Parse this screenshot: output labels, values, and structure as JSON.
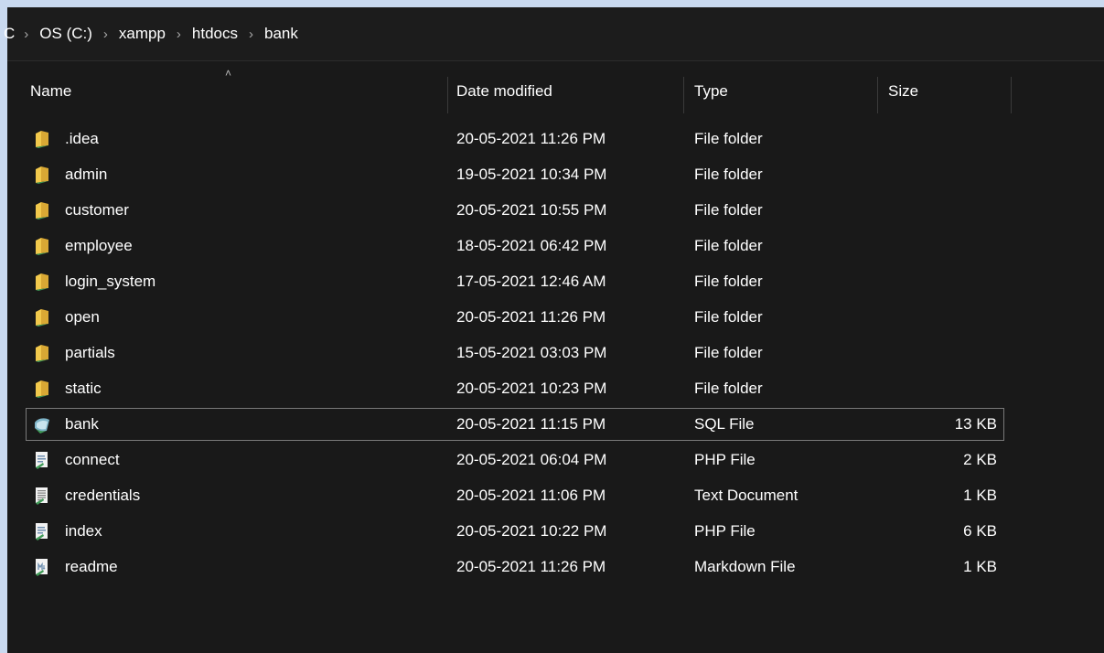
{
  "breadcrumb": {
    "items": [
      "C",
      "OS (C:)",
      "xampp",
      "htdocs",
      "bank"
    ],
    "separator": ">"
  },
  "columns": {
    "name": "Name",
    "date": "Date modified",
    "type": "Type",
    "size": "Size"
  },
  "files": [
    {
      "name": ".idea",
      "date": "20-05-2021 11:26 PM",
      "type": "File folder",
      "size": "",
      "icon": "folder-icon"
    },
    {
      "name": "admin",
      "date": "19-05-2021 10:34 PM",
      "type": "File folder",
      "size": "",
      "icon": "folder-icon"
    },
    {
      "name": "customer",
      "date": "20-05-2021 10:55 PM",
      "type": "File folder",
      "size": "",
      "icon": "folder-icon"
    },
    {
      "name": "employee",
      "date": "18-05-2021 06:42 PM",
      "type": "File folder",
      "size": "",
      "icon": "folder-icon"
    },
    {
      "name": "login_system",
      "date": "17-05-2021 12:46 AM",
      "type": "File folder",
      "size": "",
      "icon": "folder-icon"
    },
    {
      "name": "open",
      "date": "20-05-2021 11:26 PM",
      "type": "File folder",
      "size": "",
      "icon": "folder-icon"
    },
    {
      "name": "partials",
      "date": "15-05-2021 03:03 PM",
      "type": "File folder",
      "size": "",
      "icon": "folder-icon"
    },
    {
      "name": "static",
      "date": "20-05-2021 10:23 PM",
      "type": "File folder",
      "size": "",
      "icon": "folder-icon"
    },
    {
      "name": "bank",
      "date": "20-05-2021 11:15 PM",
      "type": "SQL File",
      "size": "13 KB",
      "icon": "sql-file-icon"
    },
    {
      "name": "connect",
      "date": "20-05-2021 06:04 PM",
      "type": "PHP File",
      "size": "2 KB",
      "icon": "php-file-icon"
    },
    {
      "name": "credentials",
      "date": "20-05-2021 11:06 PM",
      "type": "Text Document",
      "size": "1 KB",
      "icon": "text-file-icon"
    },
    {
      "name": "index",
      "date": "20-05-2021 10:22 PM",
      "type": "PHP File",
      "size": "6 KB",
      "icon": "php-file-icon"
    },
    {
      "name": "readme",
      "date": "20-05-2021 11:26 PM",
      "type": "Markdown File",
      "size": "1 KB",
      "icon": "markdown-file-icon"
    }
  ],
  "colors": {
    "window_bg": "#191919",
    "desktop_bg": "#c9d9ef",
    "folder": "#f2c94c"
  }
}
